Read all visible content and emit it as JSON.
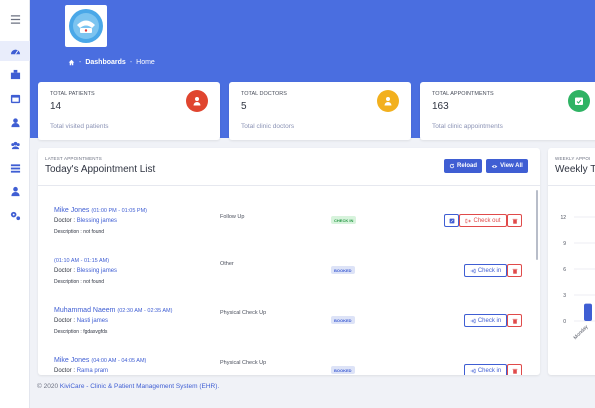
{
  "colors": {
    "primary": "#4a6ee0",
    "accent_blue": "#3f5ed3",
    "danger": "#e04a4a",
    "success": "#2a9a48",
    "warning": "#f2b01e"
  },
  "sidebar": {
    "items": [
      {
        "icon": "menu-icon"
      },
      {
        "icon": "dashboard-icon",
        "active": true
      },
      {
        "icon": "clinic-icon"
      },
      {
        "icon": "calendar-icon"
      },
      {
        "icon": "doctor-icon"
      },
      {
        "icon": "users-icon"
      },
      {
        "icon": "list-icon"
      },
      {
        "icon": "user-icon"
      },
      {
        "icon": "settings-icon"
      }
    ]
  },
  "header": {
    "logo": "logo-icon",
    "breadcrumb": {
      "section": "Dashboards",
      "page": "Home"
    }
  },
  "stats": [
    {
      "label": "Total Patients",
      "value": "14",
      "sub": "Total visited patients",
      "color": "#e0452f",
      "icon": "patient-icon"
    },
    {
      "label": "Total Doctors",
      "value": "5",
      "sub": "Total clinic doctors",
      "color": "#f2b01e",
      "icon": "doctor-icon"
    },
    {
      "label": "Total Appointments",
      "value": "163",
      "sub": "Total clinic appointments",
      "color": "#2fb364",
      "icon": "calendar-check-icon"
    }
  ],
  "appointments_card": {
    "small_title": "Latest Appointments",
    "title": "Today's Appointment List",
    "reload_label": "Reload",
    "view_all_label": "View All",
    "items": [
      {
        "name": "Mike Jones",
        "time": "(01:00 PM - 01:05 PM)",
        "doctor_label": "Doctor :",
        "doctor": "Blessing james",
        "desc_label": "Description :",
        "desc": "not found",
        "visit": "Follow Up",
        "status": "CHECK IN",
        "status_type": "checkin",
        "action": "Check out",
        "action_type": "red",
        "has_edit": true
      },
      {
        "name": "",
        "time": "(01:10 AM - 01:15 AM)",
        "doctor_label": "Doctor :",
        "doctor": "Blessing james",
        "desc_label": "Description :",
        "desc": "not found",
        "visit": "Other",
        "status": "BOOKED",
        "status_type": "booked",
        "action": "Check in",
        "action_type": "blue",
        "has_edit": false
      },
      {
        "name": "Muhammad Naeem",
        "time": "(02:30 AM - 02:35 AM)",
        "doctor_label": "Doctor :",
        "doctor": "Nasti james",
        "desc_label": "Description :",
        "desc": "fgdasvgfds",
        "visit": "Physical Check Up",
        "status": "BOOKED",
        "status_type": "booked",
        "action": "Check in",
        "action_type": "blue",
        "has_edit": false
      },
      {
        "name": "Mike Jones",
        "time": "(04:00 AM - 04:05 AM)",
        "doctor_label": "Doctor :",
        "doctor": "Rama pram",
        "desc_label": "Description :",
        "desc": "",
        "visit": "Physical Check Up",
        "status": "BOOKED",
        "status_type": "booked",
        "action": "Check in",
        "action_type": "blue",
        "has_edit": false
      }
    ]
  },
  "weekly_card": {
    "small_title": "Weekly Appoi",
    "title": "Weekly To",
    "chart_data": {
      "type": "bar",
      "categories": [
        "Monday"
      ],
      "values": [
        2
      ],
      "y_ticks": [
        "12",
        "9",
        "6",
        "3",
        "0"
      ],
      "ylim": [
        0,
        12
      ],
      "grid": true
    }
  },
  "footer": {
    "prefix": "© 2020",
    "brand": "KiviCare - Clinic & Patient Management System (EHR)."
  }
}
